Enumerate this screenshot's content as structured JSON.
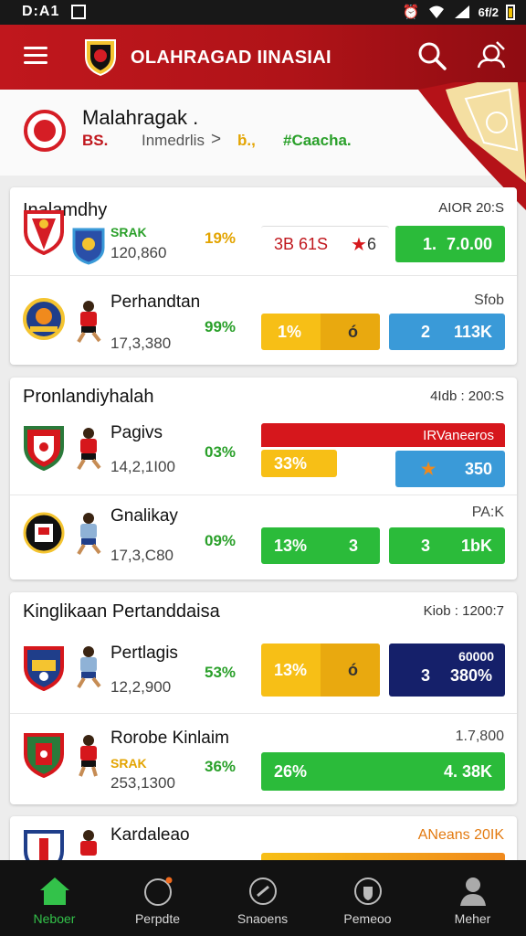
{
  "status_bar": {
    "time": "D:A1",
    "battery": "6f/2"
  },
  "app_bar": {
    "title": "OLAHRAGAD IINASIAI",
    "icons": [
      "menu-icon",
      "club-logo",
      "search-icon",
      "profile-edit-icon"
    ]
  },
  "summary": {
    "title": "Malahragak .",
    "code": "BS.",
    "link": "Inmedrlis",
    "chevron": ">",
    "score": "ḃ.,",
    "tag": "#Caacha."
  },
  "cards": [
    {
      "title": "Inalamdhy",
      "meta": "AIOR 20:S",
      "rows": [
        {
          "name": "",
          "sub": "SRAK",
          "num": "120,860",
          "pct": "19%",
          "pct_color": "#e3a400",
          "has_player": false,
          "extra": "",
          "chips": [
            {
              "kind": "white",
              "left": "3B 61S",
              "right": "6"
            },
            {
              "kind": "g",
              "left": "1.",
              "right": "7.0.00"
            }
          ]
        },
        {
          "name": "Perhandtan",
          "sub": "",
          "num": "17,3,380",
          "pct": "99%",
          "pct_color": "#2aa02a",
          "has_player": true,
          "extra": "Sfob",
          "chips": [
            {
              "kind": "y",
              "left": "1%",
              "right": "ó"
            },
            {
              "kind": "b",
              "left": "2",
              "right": "113K"
            }
          ]
        }
      ]
    },
    {
      "title": "Pronlandiyhalah",
      "meta": "4Idb : 200:S",
      "rows": [
        {
          "name": "Pagivs",
          "sub": "",
          "num": "14,2,1I00",
          "pct": "03%",
          "pct_color": "#2aa02a",
          "has_player": true,
          "extra": "",
          "red_bar": "IRVaneeros",
          "chips": [
            {
              "kind": "y",
              "left": "33%",
              "right": ""
            },
            {
              "kind": "b",
              "left": "★",
              "right": "350"
            }
          ]
        },
        {
          "name": "Gnalikay",
          "sub": "",
          "num": "17,3,C80",
          "pct": "09%",
          "pct_color": "#2aa02a",
          "has_player": true,
          "extra": "PA:K",
          "chips": [
            {
              "kind": "g",
              "left": "13%",
              "right": "3"
            },
            {
              "kind": "g",
              "left": "3",
              "right": "1bK"
            }
          ]
        }
      ]
    },
    {
      "title": "Kinglikaan Pertanddaisa",
      "meta": "Kiob : 1200:7",
      "rows": [
        {
          "name": "Pertlagis",
          "sub": "",
          "num": "12,2,900",
          "pct": "53%",
          "pct_color": "#2aa02a",
          "has_player": true,
          "extra": "",
          "chips": [
            {
              "kind": "y",
              "left": "13%",
              "right": "ó"
            },
            {
              "kind": "n",
              "left": "3",
              "right": "380%",
              "top": "60000"
            }
          ]
        },
        {
          "name": "Rorobe Kinlaim",
          "sub": "SRAK",
          "num": "253,1300",
          "pct": "36%",
          "pct_color": "#2aa02a",
          "has_player": true,
          "extra": "1.7,800",
          "chips": [
            {
              "kind": "g",
              "left": "26%",
              "right": "4. 38K"
            }
          ]
        }
      ]
    },
    {
      "title": "Kardaleao",
      "meta": "ANeans 20IK",
      "rows": [
        {
          "name": "",
          "sub": "",
          "num": "",
          "pct": "",
          "pct_color": "#2aa02a",
          "has_player": true,
          "extra": ""
        }
      ]
    }
  ],
  "bottom_nav": [
    {
      "label": "Neboer",
      "icon": "home-icon",
      "active": true
    },
    {
      "label": "Perpdte",
      "icon": "circle-icon",
      "active": false
    },
    {
      "label": "Snaoens",
      "icon": "ball-icon",
      "active": false
    },
    {
      "label": "Pemeoo",
      "icon": "shield-icon",
      "active": false
    },
    {
      "label": "Meher",
      "icon": "person-icon",
      "active": false
    }
  ]
}
